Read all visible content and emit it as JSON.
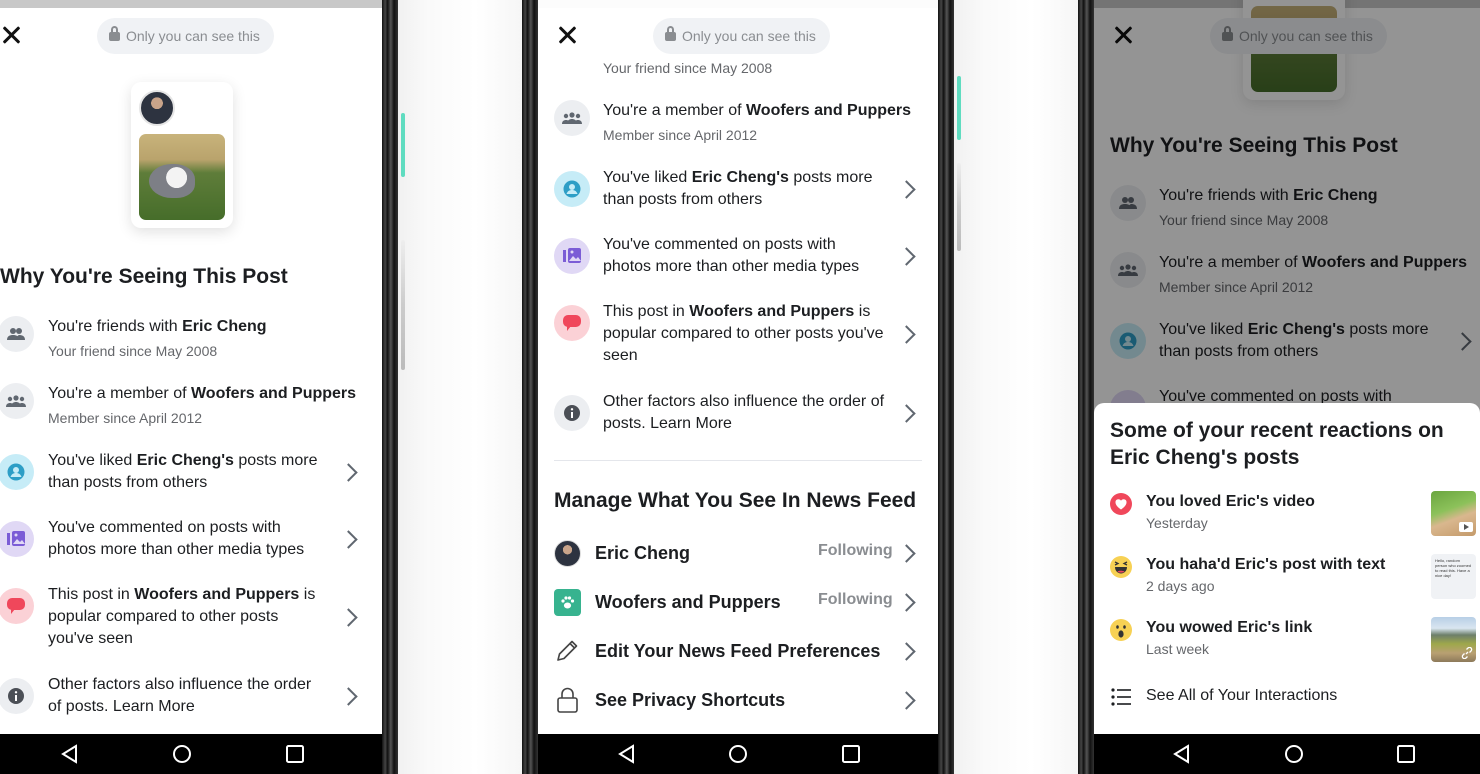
{
  "privacy_pill": "Only you can see this",
  "section_why_title": "Why You're Seeing This Post",
  "reasons": [
    {
      "pre": "You're friends with ",
      "bold": "Eric Cheng",
      "post": "",
      "sub": "Your friend since May 2008",
      "icon": "friends-icon",
      "has_chevron": false
    },
    {
      "pre": "You're a member of ",
      "bold": "Woofers and Puppers",
      "post": "",
      "sub": "Member since April 2012",
      "icon": "group-icon",
      "has_chevron": false
    },
    {
      "pre": "You've liked ",
      "bold": "Eric Cheng's",
      "post": " posts more than posts from others",
      "sub": "",
      "icon": "profile-icon",
      "has_chevron": true
    },
    {
      "pre": "You've commented on posts with photos more than other media types",
      "bold": "",
      "post": "",
      "sub": "",
      "icon": "photos-icon",
      "has_chevron": true
    },
    {
      "pre": "This post in ",
      "bold": "Woofers and Puppers",
      "post": " is popular compared to other posts you've seen",
      "sub": "",
      "icon": "comment-bubble-icon",
      "has_chevron": true
    },
    {
      "pre": "Other factors also influence the order of posts. Learn More",
      "bold": "",
      "post": "",
      "sub": "",
      "icon": "info-icon",
      "has_chevron": true
    }
  ],
  "manage": {
    "title": "Manage What You See In News Feed",
    "items": [
      {
        "label": "Eric Cheng",
        "status": "Following",
        "icon": "avatar"
      },
      {
        "label": "Woofers and Puppers",
        "status": "Following",
        "icon": "paw-icon"
      },
      {
        "label": "Edit Your News Feed Preferences",
        "status": "",
        "icon": "pencil-icon"
      },
      {
        "label": "See Privacy Shortcuts",
        "status": "",
        "icon": "lock-icon"
      }
    ]
  },
  "reactions_sheet": {
    "title": "Some of your recent reactions on Eric Cheng's posts",
    "items": [
      {
        "title": "You loved Eric's video",
        "time": "Yesterday",
        "reaction": "love-reaction-icon",
        "thumb": "video"
      },
      {
        "title": "You haha'd Eric's post with text",
        "time": "2 days ago",
        "reaction": "haha-reaction-icon",
        "thumb": "text",
        "thumb_text": "Hello, random person who zoomed to read this. Have a nice day!"
      },
      {
        "title": "You wowed Eric's link",
        "time": "Last week",
        "reaction": "wow-reaction-icon",
        "thumb": "link"
      }
    ],
    "see_all": "See All of Your Interactions"
  },
  "colors": {
    "accent_teal": "#37b38f",
    "love_red": "#f0475b",
    "haha_yellow": "#f7d154"
  }
}
